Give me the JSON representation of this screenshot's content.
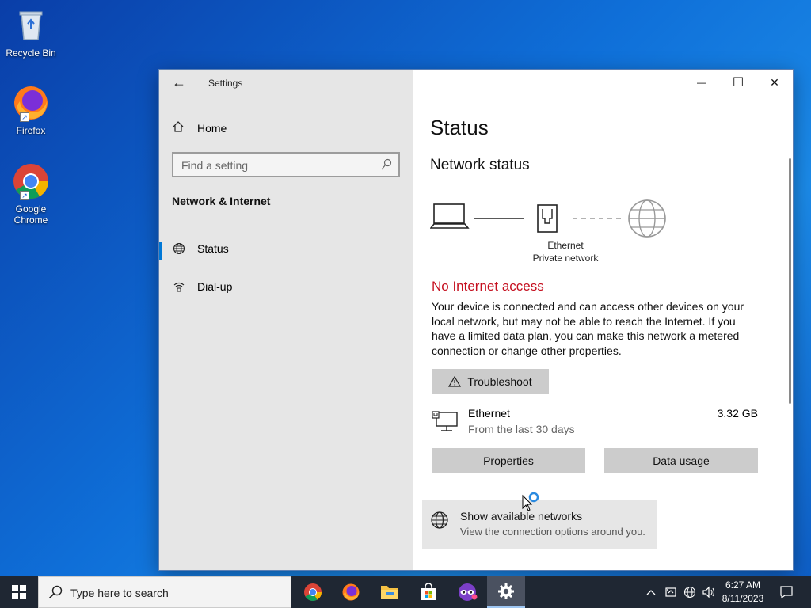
{
  "desktop": {
    "icons": [
      {
        "label": "Recycle Bin"
      },
      {
        "label": "Firefox"
      },
      {
        "label": "Google Chrome"
      }
    ]
  },
  "window": {
    "title": "Settings",
    "back_glyph": "←",
    "controls": {
      "minimize": "—",
      "maximize": "☐",
      "close": "✕"
    },
    "sidebar": {
      "home_label": "Home",
      "search_placeholder": "Find a setting",
      "section_title": "Network & Internet",
      "items": [
        {
          "label": "Status",
          "icon": "globe-icon",
          "active": true
        },
        {
          "label": "Dial-up",
          "icon": "dialup-icon",
          "active": false
        }
      ]
    },
    "main": {
      "title": "Status",
      "subtitle": "Network status",
      "diagram": {
        "connection_name": "Ethernet",
        "network_profile": "Private network"
      },
      "alert": "No Internet access",
      "description": "Your device is connected and can access other devices on your local network, but may not be able to reach the Internet. If you have a limited data plan, you can make this network a metered connection or change other properties.",
      "troubleshoot_label": "Troubleshoot",
      "usage": {
        "name": "Ethernet",
        "period": "From the last 30 days",
        "amount": "3.32 GB"
      },
      "properties_label": "Properties",
      "data_usage_label": "Data usage",
      "show_networks": {
        "title": "Show available networks",
        "subtitle": "View the connection options around you."
      }
    },
    "colors": {
      "accent": "#0078d7",
      "error": "#c50f1f",
      "sidebar_bg": "#e6e6e6"
    }
  },
  "taskbar": {
    "search_placeholder": "Type here to search",
    "apps": [
      "chrome-icon",
      "firefox-icon",
      "file-explorer-icon",
      "store-icon",
      "mask-app-icon",
      "settings-icon"
    ],
    "clock": {
      "time": "6:27 AM",
      "date": "8/11/2023"
    }
  }
}
